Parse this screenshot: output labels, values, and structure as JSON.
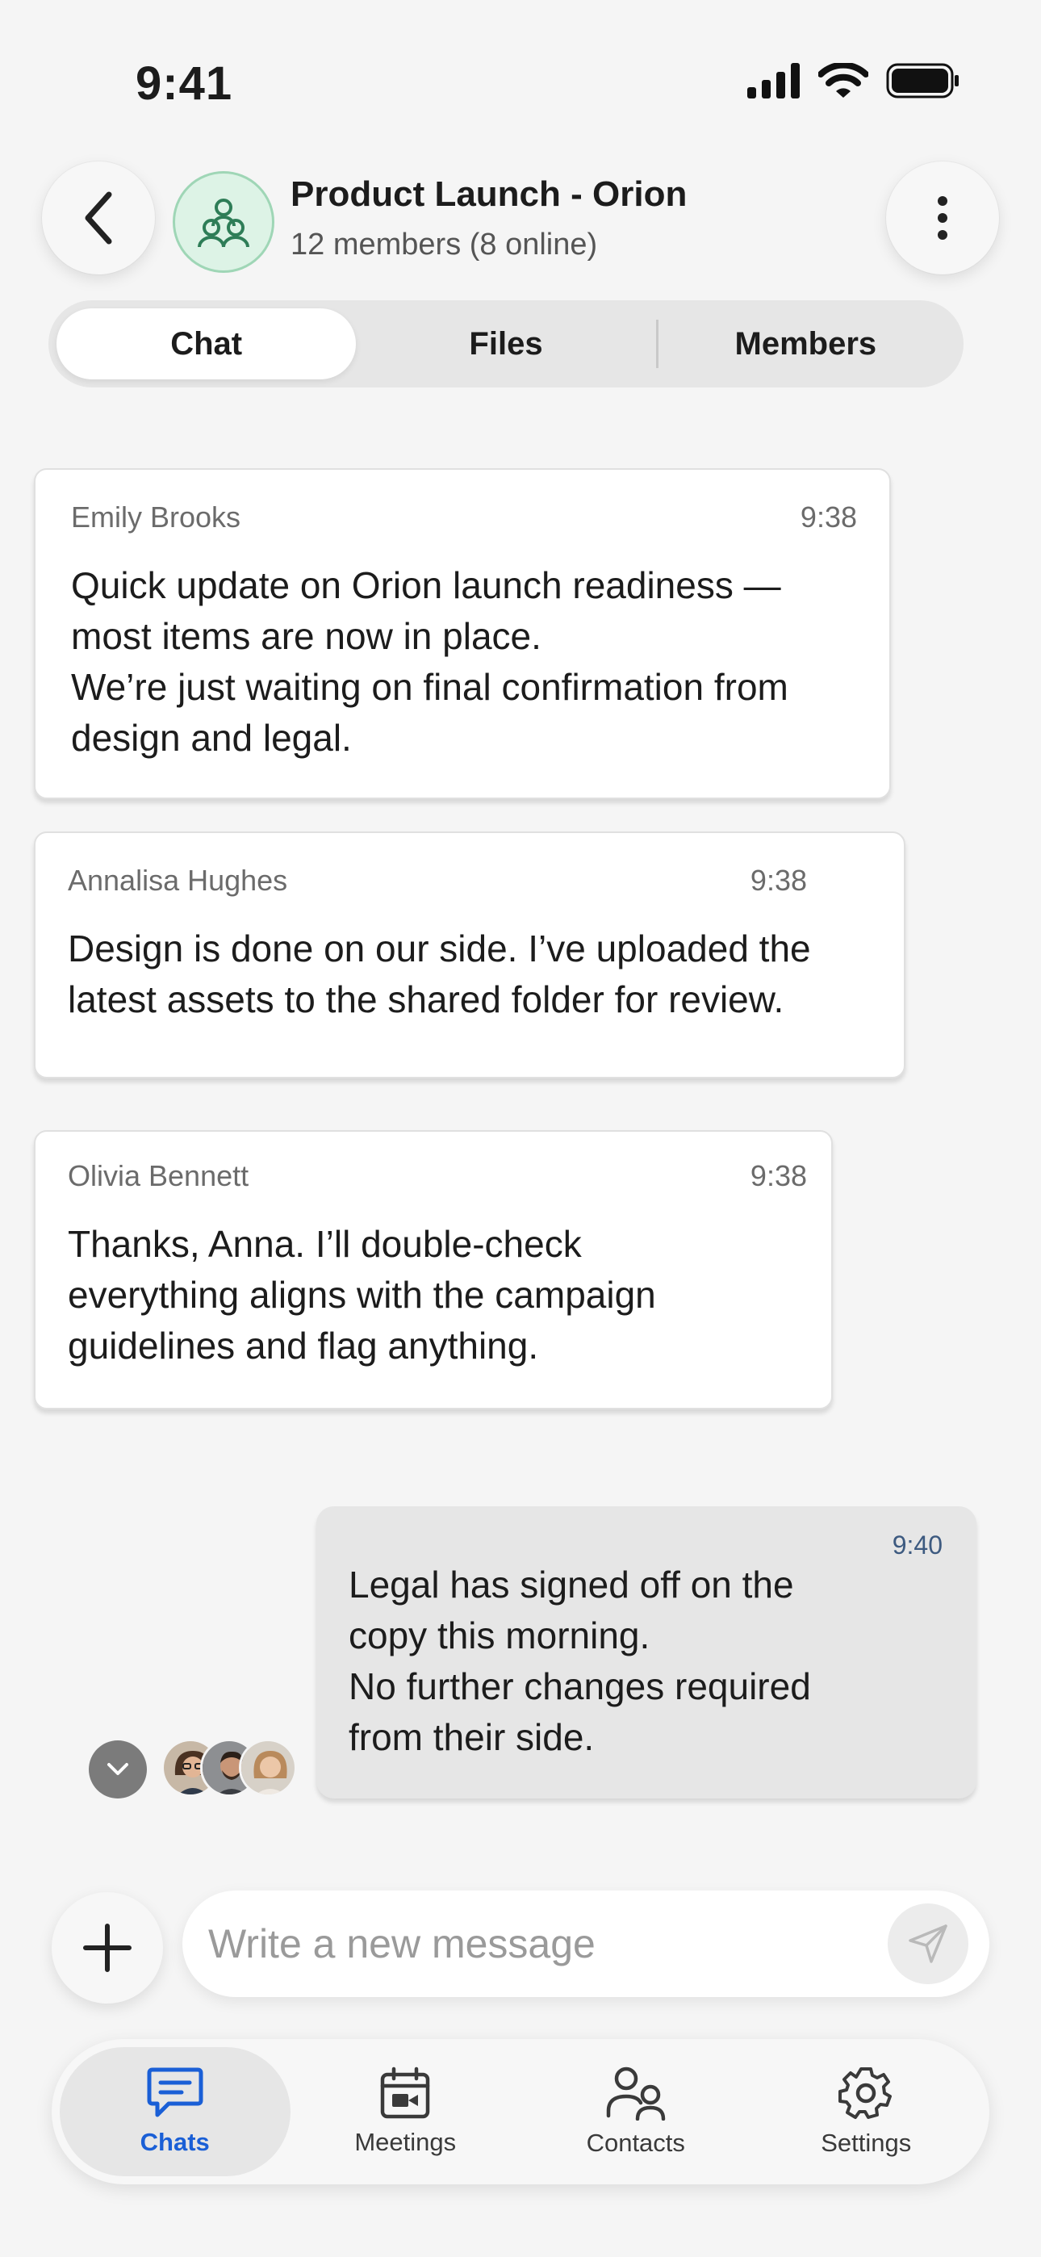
{
  "status_bar": {
    "time": "9:41"
  },
  "header": {
    "title": "Product Launch - Orion",
    "subtitle": "12 members (8 online)"
  },
  "tabs": [
    {
      "label": "Chat",
      "active": true
    },
    {
      "label": "Files",
      "active": false
    },
    {
      "label": "Members",
      "active": false
    }
  ],
  "messages": [
    {
      "sender": "Emily Brooks",
      "time": "9:38",
      "lines": [
        "Quick update on Orion launch readiness —",
        "most items are now in place.",
        "We’re just waiting on final confirmation from",
        "design and legal."
      ]
    },
    {
      "sender": "Annalisa Hughes",
      "time": "9:38",
      "lines": [
        "Design is done on our side. I’ve uploaded the",
        "latest assets to the shared folder for review."
      ]
    },
    {
      "sender": "Olivia Bennett",
      "time": "9:38",
      "lines": [
        "Thanks, Anna.  I’ll double-check",
        "everything aligns with the campaign",
        "guidelines and flag anything."
      ]
    }
  ],
  "own_message": {
    "time": "9:40",
    "lines": [
      "Legal has signed off on the",
      "copy this morning.",
      "No further changes required",
      "from their side."
    ]
  },
  "read_receipts": [
    "reader-avatar-1",
    "reader-avatar-2",
    "reader-avatar-3"
  ],
  "composer": {
    "placeholder": "Write a new message"
  },
  "tabbar": [
    {
      "label": "Chats",
      "icon": "chat-bubble-icon",
      "active": true
    },
    {
      "label": "Meetings",
      "icon": "calendar-video-icon",
      "active": false
    },
    {
      "label": "Contacts",
      "icon": "contacts-icon",
      "active": false
    },
    {
      "label": "Settings",
      "icon": "gear-icon",
      "active": false
    }
  ],
  "colors": {
    "accent": "#1a5fd6",
    "background": "#f5f5f5",
    "group_avatar_bg": "#ddf3e6",
    "group_avatar_icon": "#2e7d57",
    "own_time": "#3d5a80"
  }
}
